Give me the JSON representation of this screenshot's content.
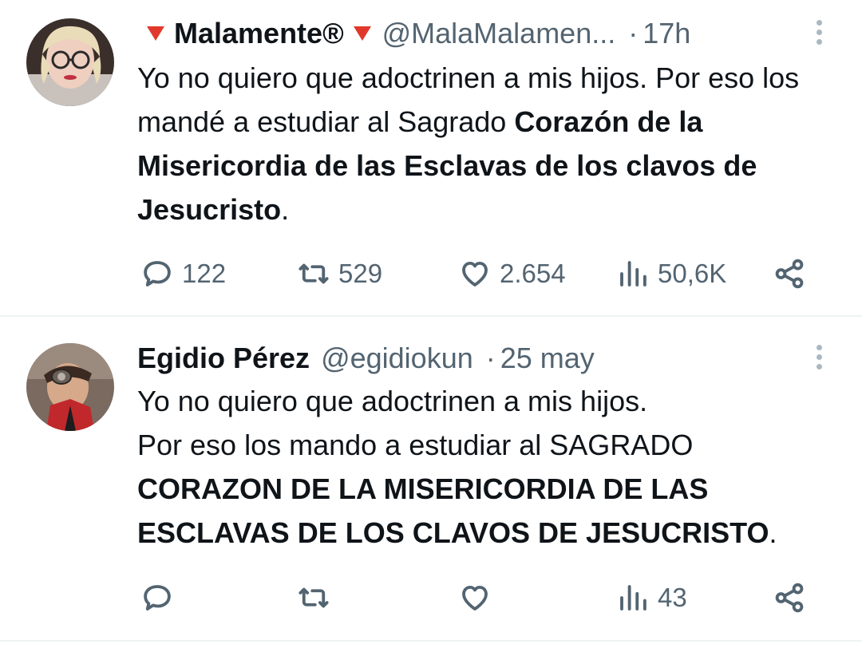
{
  "tweets": [
    {
      "name": "Malamente®",
      "handle": "@MalaMalamen...",
      "separator": "·",
      "time": "17h",
      "text_plain": "Yo no quiero que adoctrinen a mis hijos. Por eso los mandé a estudiar al Sagrado ",
      "text_bold": "Corazón de la Misericordia de las Esclavas de los clavos de Jesucristo",
      "text_end": ".",
      "replies": "122",
      "retweets": "529",
      "likes": "2.654",
      "views": "50,6K"
    },
    {
      "name": "Egidio Pérez",
      "handle": "@egidiokun",
      "separator": "·",
      "time": "25 may",
      "text_line1": "Yo no quiero que adoctrinen a mis hijos.",
      "text_plain": "Por eso los mando a estudiar al SAGRADO ",
      "text_bold": "CORAZON DE LA MISERICORDIA DE LAS ESCLAVAS DE LOS CLAVOS DE JESUCRISTO",
      "text_end": ".",
      "replies": "",
      "retweets": "",
      "likes": "",
      "views": "43"
    }
  ],
  "icons": [
    "reply-icon",
    "retweet-icon",
    "like-icon",
    "views-icon",
    "share-icon",
    "more-options-icon",
    "red-triangle-icon"
  ],
  "colors": {
    "text": "#0f1419",
    "secondary": "#536471",
    "divider": "#eff3f4",
    "flag": "#e0392b"
  }
}
